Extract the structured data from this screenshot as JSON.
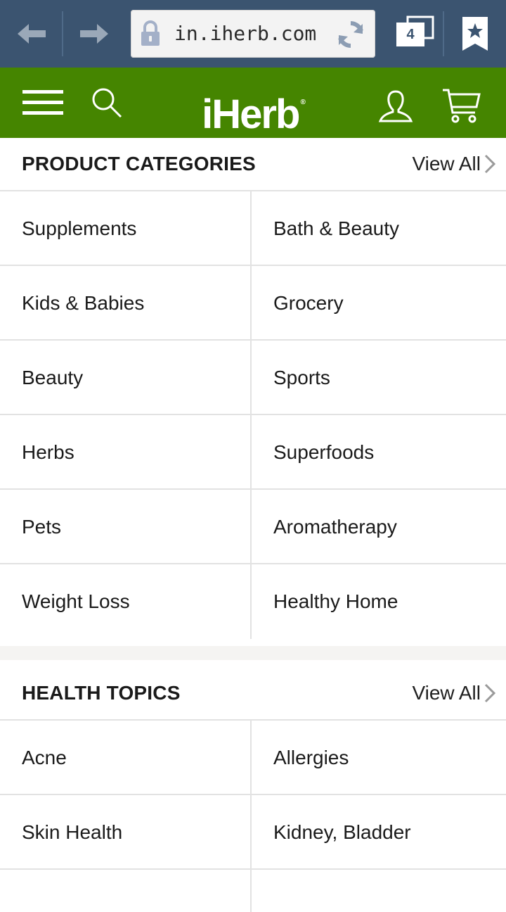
{
  "browser": {
    "url": "in.iherb.com",
    "tab_count": "4"
  },
  "site": {
    "logo_text": "iHerb",
    "logo_mark": "®",
    "brand_color": "#458500"
  },
  "product_categories": {
    "title": "PRODUCT CATEGORIES",
    "view_all": "View All",
    "items": [
      "Supplements",
      "Bath & Beauty",
      "Kids & Babies",
      "Grocery",
      "Beauty",
      "Sports",
      "Herbs",
      "Superfoods",
      "Pets",
      "Aromatherapy",
      "Weight Loss",
      "Healthy Home"
    ]
  },
  "health_topics": {
    "title": "HEALTH TOPICS",
    "view_all": "View All",
    "items": [
      "Acne",
      "Allergies",
      "Skin Health",
      "Kidney, Bladder",
      "",
      ""
    ]
  },
  "icons": {
    "back": "back-arrow-icon",
    "forward": "forward-arrow-icon",
    "lock": "lock-icon",
    "reload": "reload-icon",
    "tabs": "tabs-icon",
    "bookmark": "bookmark-star-icon",
    "menu": "hamburger-menu-icon",
    "search": "search-icon",
    "account": "account-icon",
    "cart": "cart-icon",
    "chevron": "chevron-right-icon"
  }
}
